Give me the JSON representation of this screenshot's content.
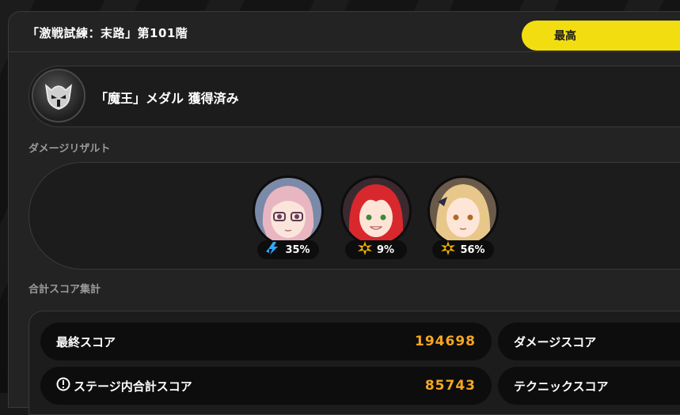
{
  "header": {
    "title": "「激戦試練：末路」第101階",
    "best_label": "最高"
  },
  "medal": {
    "text": "「魔王」メダル 獲得済み",
    "icon": "helmet-icon"
  },
  "damage_result": {
    "label": "ダメージリザルト",
    "characters": [
      {
        "name": "pink-hair-glasses",
        "element_icon": "lightning-icon",
        "element_color": "#2fa8ff",
        "percent": "35%"
      },
      {
        "name": "red-hair",
        "element_icon": "burst-icon",
        "element_color": "#f2b000",
        "percent": "9%"
      },
      {
        "name": "blonde-hair",
        "element_icon": "burst-icon",
        "element_color": "#f2b000",
        "percent": "56%"
      }
    ]
  },
  "score_summary": {
    "label": "合計スコア集計",
    "final_label": "最終スコア",
    "final_value": "194698",
    "damage_score_label": "ダメージスコア",
    "stage_total_label": "ステージ内合計スコア",
    "stage_total_value": "85743",
    "technique_score_label": "テクニックスコア"
  },
  "colors": {
    "accent_yellow": "#f2de10",
    "score_orange": "#f5a623"
  }
}
